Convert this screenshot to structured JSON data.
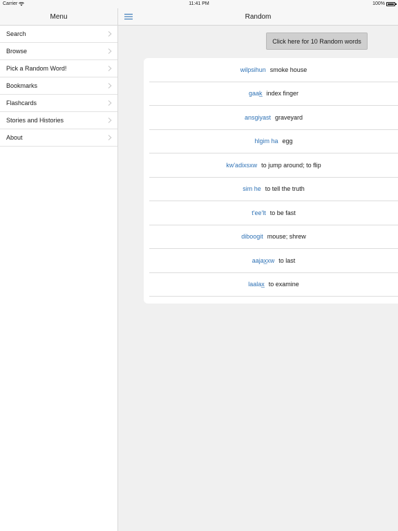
{
  "status_bar": {
    "carrier": "Carrier",
    "time": "11:41 PM",
    "battery": "100%"
  },
  "sidebar": {
    "title": "Menu",
    "items": [
      {
        "label": "Search"
      },
      {
        "label": "Browse"
      },
      {
        "label": "Pick a Random Word!"
      },
      {
        "label": "Bookmarks"
      },
      {
        "label": "Flashcards"
      },
      {
        "label": "Stories and Histories"
      },
      {
        "label": "About"
      }
    ]
  },
  "main": {
    "title": "Random",
    "random_button_label": "Click here for 10 Random words",
    "words": [
      {
        "term": "wilpsihun",
        "definition": "smoke house"
      },
      {
        "term": "gaak̲",
        "definition": "index finger"
      },
      {
        "term": "ansgiyast",
        "definition": "graveyard"
      },
      {
        "term": "hlgim ha",
        "definition": "egg"
      },
      {
        "term": "kw'adixsxw",
        "definition": "to jump around; to flip"
      },
      {
        "term": "sim he",
        "definition": "to tell the truth"
      },
      {
        "term": "t'ee'lt",
        "definition": "to be fast"
      },
      {
        "term": "diboogit",
        "definition": "mouse; shrew"
      },
      {
        "term": "aajax̲xw",
        "definition": "to last"
      },
      {
        "term": "laalax̲",
        "definition": "to examine"
      }
    ]
  },
  "colors": {
    "accent": "#2f72b5",
    "button_bg": "#cfcfcf",
    "background": "#f0f0f0"
  },
  "icons": {
    "hamburger": "hamburger-icon",
    "chevron": "chevron-right-icon",
    "wifi": "wifi-icon",
    "battery": "battery-icon"
  }
}
